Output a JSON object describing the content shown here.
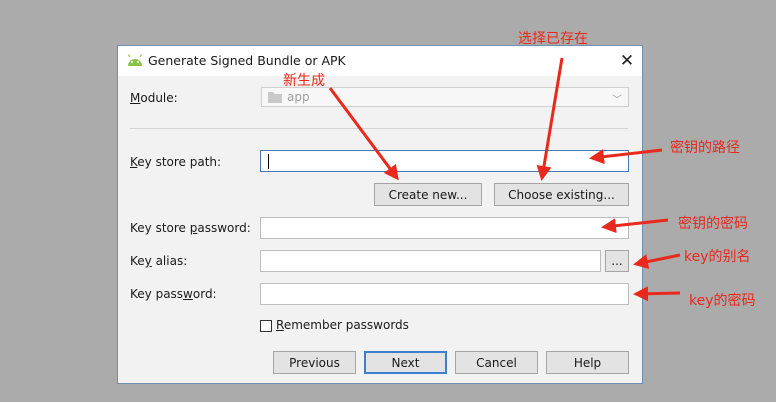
{
  "dialog": {
    "title": "Generate Signed Bundle or APK",
    "close_glyph": "✕"
  },
  "module": {
    "label_prefix": "",
    "label_mnemonic": "M",
    "label_rest": "odule:",
    "value": "app"
  },
  "key_store_path": {
    "label_mnemonic": "K",
    "label_rest": "ey store path:",
    "value": ""
  },
  "buttons": {
    "create_new": "Create new...",
    "choose_existing": "Choose existing...",
    "browse": "...",
    "previous": "Previous",
    "next": "Next",
    "cancel": "Cancel",
    "help": "Help"
  },
  "key_store_password": {
    "label_prefix": "Key store ",
    "label_mnemonic": "p",
    "label_rest": "assword:",
    "value": ""
  },
  "key_alias": {
    "label_prefix": "Ke",
    "label_mnemonic": "y",
    "label_rest": " alias:",
    "value": ""
  },
  "key_password": {
    "label_prefix": "Key pass",
    "label_mnemonic": "w",
    "label_rest": "ord:",
    "value": ""
  },
  "remember": {
    "label_mnemonic": "R",
    "label_rest": "emember passwords",
    "checked": false
  },
  "annotations": {
    "choose_existing_note": "选择已存在",
    "create_new_note": "新生成",
    "key_path_note": "密钥的路径",
    "keystore_password_note": "密钥的密码",
    "alias_note": "key的别名",
    "key_password_note": "key的密码"
  },
  "colors": {
    "annotation": "#e8291c",
    "primary_border": "#3c7fd1",
    "background": "#ababab"
  }
}
